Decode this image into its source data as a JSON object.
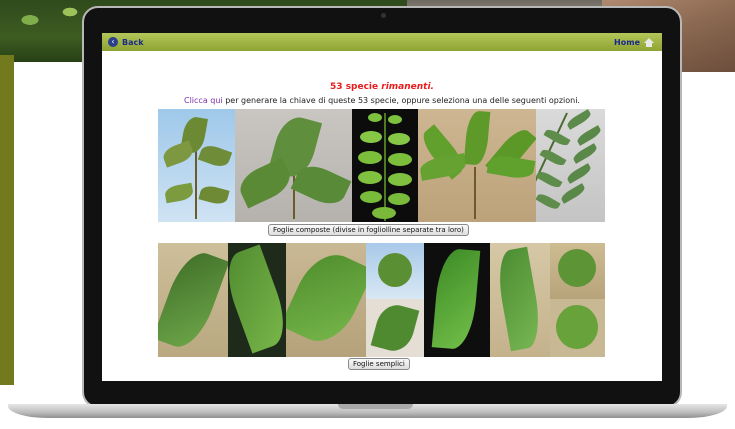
{
  "nav": {
    "back_label": "Back",
    "home_label": "Home"
  },
  "status": {
    "count": "53",
    "word_specie": "specie",
    "word_rimanenti": "rimanenti."
  },
  "instructions": {
    "link_text": "Clicca qui",
    "rest": " per generare la chiave di queste 53 specie, oppure seleziona una delle seguenti opzioni."
  },
  "options": {
    "composite_label": "Foglie composte (divise in fogliolline separate tra loro)",
    "simple_label": "Foglie semplici"
  },
  "icons": {
    "back": "back-arrow-icon",
    "home": "home-icon"
  },
  "colors": {
    "topbar": "#9fb444",
    "count_red": "#e81c1c",
    "link_purple": "#7b2fa8",
    "nav_blue": "#1b2a8a"
  }
}
